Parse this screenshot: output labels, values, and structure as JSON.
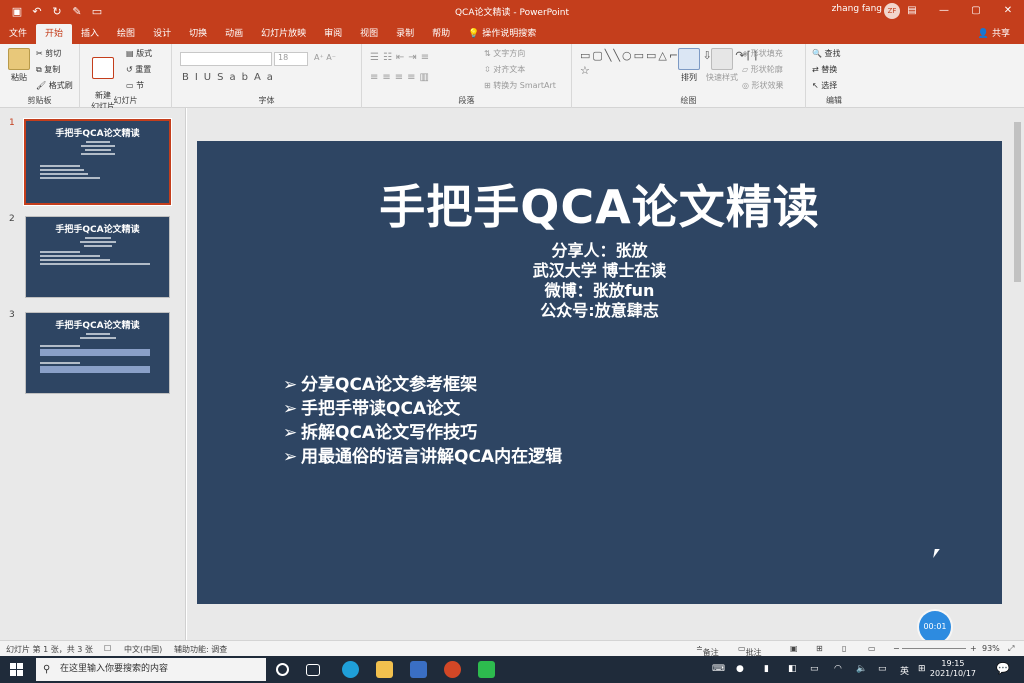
{
  "window": {
    "title": "QCA论文精读 - PowerPoint",
    "user": "zhang fang",
    "avatar_initials": "ZF"
  },
  "tabs": [
    "文件",
    "开始",
    "插入",
    "绘图",
    "设计",
    "切换",
    "动画",
    "幻灯片放映",
    "审阅",
    "视图",
    "录制",
    "帮助"
  ],
  "active_tab": "开始",
  "tell_me": "操作说明搜索",
  "share": "共享",
  "ribbon": {
    "clipboard": {
      "label": "剪贴板",
      "paste": "粘贴",
      "cut": "剪切",
      "copy": "复制",
      "format_painter": "格式刷"
    },
    "slides": {
      "label": "幻灯片",
      "new_slide": "新建\n幻灯片",
      "layout": "版式",
      "reset": "重置",
      "section": "节"
    },
    "font": {
      "label": "字体",
      "size": "18"
    },
    "paragraph": {
      "label": "段落",
      "text_direction": "文字方向",
      "align_text": "对齐文本",
      "smartart": "转换为 SmartArt"
    },
    "drawing": {
      "label": "绘图",
      "arrange": "排列",
      "quick_styles": "快速样式",
      "shape_fill": "形状填充",
      "shape_outline": "形状轮廓",
      "shape_effects": "形状效果"
    },
    "editing": {
      "label": "编辑",
      "find": "查找",
      "replace": "替换",
      "select": "选择"
    }
  },
  "thumbnails": [
    {
      "number": "1",
      "title": "手把手QCA论文精读"
    },
    {
      "number": "2",
      "title": "手把手QCA论文精读"
    },
    {
      "number": "3",
      "title": "手把手QCA论文精读"
    }
  ],
  "slide": {
    "title": "手把手QCA论文精读",
    "subtitle_lines": [
      "分享人：张放",
      "武汉大学 博士在读",
      "微博：张放fun",
      "公众号:放意肆志"
    ],
    "bullets": [
      "分享QCA论文参考框架",
      "手把手带读QCA论文",
      "拆解QCA论文写作技巧",
      "用最通俗的语言讲解QCA内在逻辑"
    ],
    "bullet_marker": "➢"
  },
  "timer": "00:01",
  "status": {
    "slide_info": "幻灯片 第 1 张，共 3 张",
    "language": "中文(中国)",
    "accessibility": "辅助功能: 调查",
    "notes": "备注",
    "comments": "批注",
    "zoom": "93%"
  },
  "taskbar": {
    "search_placeholder": "在这里输入你要搜索的内容",
    "time": "19:15",
    "date": "2021/10/17",
    "ime": "英"
  },
  "colors": {
    "accent": "#c43e1c",
    "slide_bg": "#2e4563",
    "taskbar": "#1f2b3a"
  }
}
